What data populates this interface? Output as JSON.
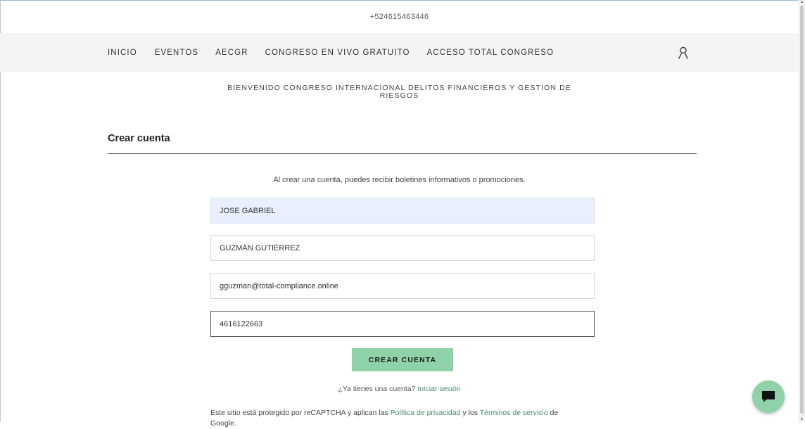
{
  "topbar": {
    "phone": "+524615463446"
  },
  "nav": {
    "items": [
      {
        "label": "INICIO"
      },
      {
        "label": "EVENTOS"
      },
      {
        "label": "AECGR"
      },
      {
        "label": "CONGRESO EN VIVO GRATUITO"
      },
      {
        "label": "ACCESO TOTAL CONGRESO"
      }
    ],
    "account_icon": "user-icon"
  },
  "welcome": {
    "line1": "BIENVENIDO CONGRESO INTERNACIONAL DELITOS FINANCIEROS Y GESTIÓN DE",
    "line2": "RIESGOS"
  },
  "form": {
    "title": "Crear cuenta",
    "info": "Al crear una cuenta, puedes recibir boletines informativos o promociones.",
    "first_name": "JOSE GABRIEL",
    "last_name": "GUZMÁN GUTIÉRREZ",
    "email": "gguzman@total-compliance.online",
    "phone": "4616122663",
    "submit_label": "CREAR CUENTA",
    "login_prompt": "¿Ya tienes una cuenta?",
    "login_link": "Iniciar sesión"
  },
  "recaptcha": {
    "prefix": "Este sitio está protegido por reCAPTCHA y aplican las",
    "privacy_link": "Política de privacidad",
    "middle": "y los",
    "terms_link": "Términos de servicio",
    "suffix": "de",
    "line2": "Google."
  },
  "chat": {
    "icon": "chat-bubble-icon"
  },
  "colors": {
    "accent": "#8fd2aa",
    "nav_bg": "#f4f4f4",
    "autofill_bg": "#e8f0fe",
    "link": "#4a8a68"
  }
}
